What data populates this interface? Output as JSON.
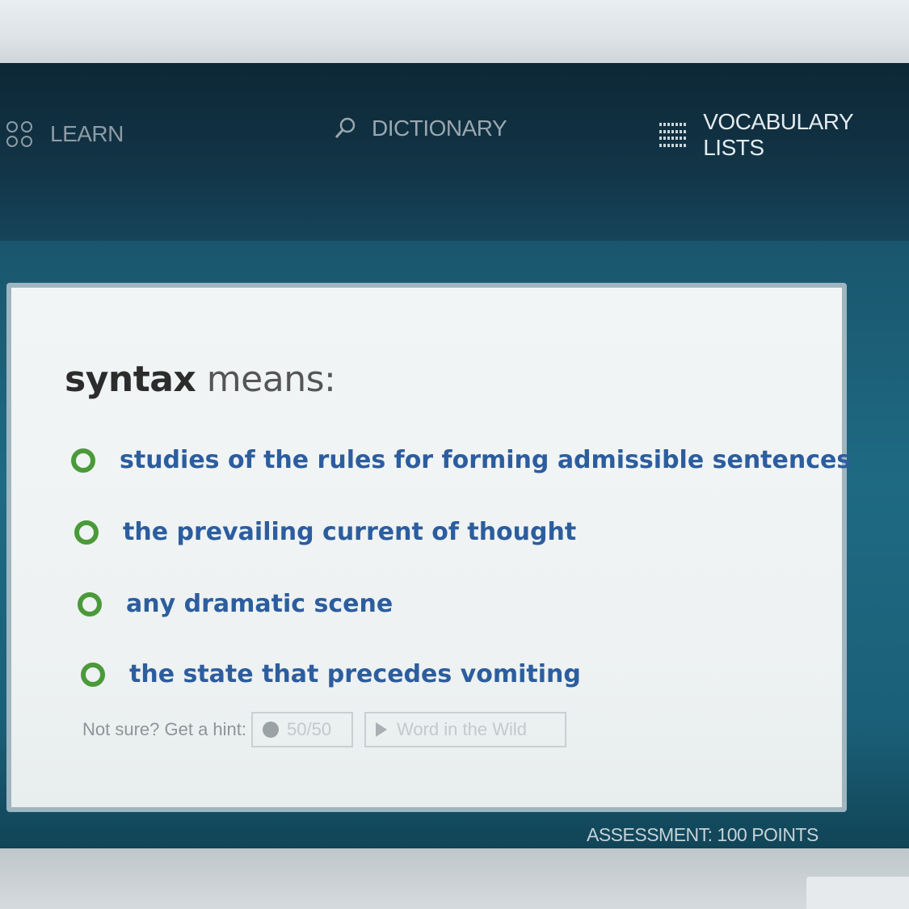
{
  "nav": {
    "learn_label": "LEARN",
    "dictionary_label": "DICTIONARY",
    "vocab_label": "VOCABULARY LISTS",
    "learn_icon": "grid-icon",
    "dictionary_icon": "search-icon",
    "vocab_icon": "list-icon"
  },
  "question": {
    "word": "syntax",
    "prompt": " means:"
  },
  "choices": [
    {
      "label": "studies of the rules for forming admissible sentences"
    },
    {
      "label": "the prevailing current of thought"
    },
    {
      "label": "any dramatic scene"
    },
    {
      "label": "the state that precedes vomiting"
    }
  ],
  "hint": {
    "label": "Not sure? Get a hint:",
    "fifty_label": "50/50",
    "wild_label": "Word in the Wild"
  },
  "footer": {
    "assessment": "ASSESSMENT: 100 POINTS"
  },
  "colors": {
    "radio_border": "#4a9a3a",
    "choice_text": "#2c5d9e",
    "card_bg": "#f2f5f5",
    "teal_bg": "#1f6a83"
  }
}
